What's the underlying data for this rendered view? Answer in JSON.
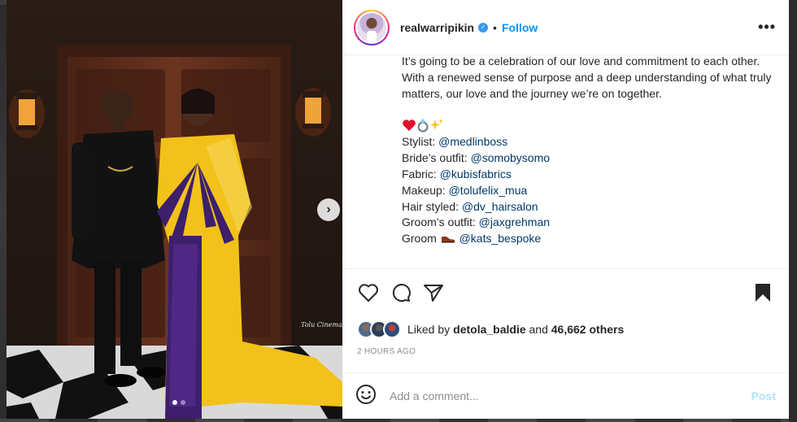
{
  "post": {
    "username": "realwarripikin",
    "follow_label": "Follow",
    "separator": "•",
    "more_label": "•••",
    "verified_glyph": "✓"
  },
  "caption": {
    "paragraph": "It’s going to be a celebration of our love and commitment to each other. With a renewed sense of purpose and a deep understanding of what truly matters, our love and the journey we’re on together.",
    "emojis": [
      "red-heart",
      "ring",
      "sparkles"
    ],
    "credits": [
      {
        "label": "Stylist: ",
        "handle": "@medlinboss"
      },
      {
        "label": "Bride’s outfit: ",
        "handle": "@somobysomo"
      },
      {
        "label": "Fabric: ",
        "handle": "@kubisfabrics"
      },
      {
        "label": "Makeup: ",
        "handle": "@tolufelix_mua"
      },
      {
        "label": "Hair styled: ",
        "handle": "@dv_hairsalon"
      },
      {
        "label": "Groom’s outfit: ",
        "handle": "@jaxgrehman"
      },
      {
        "label": "Groom ",
        "icon": "shoe-icon",
        "handle": "@kats_bespoke"
      }
    ]
  },
  "likes": {
    "prefix": "Liked by ",
    "first_liker": "detola_baldie",
    "middle": " and ",
    "count": "46,662 others"
  },
  "timestamp": "2 HOURS AGO",
  "comment": {
    "placeholder": "Add a comment...",
    "post_label": "Post"
  },
  "media": {
    "watermark": "Tolu Cinema",
    "slide_count": 2,
    "active_slide": 1
  },
  "colors": {
    "link": "#00376b",
    "follow": "#0095f6",
    "post_disabled": "#b2dffc",
    "dress_yellow": "#f2c21b",
    "dress_purple": "#3d1f6b"
  }
}
